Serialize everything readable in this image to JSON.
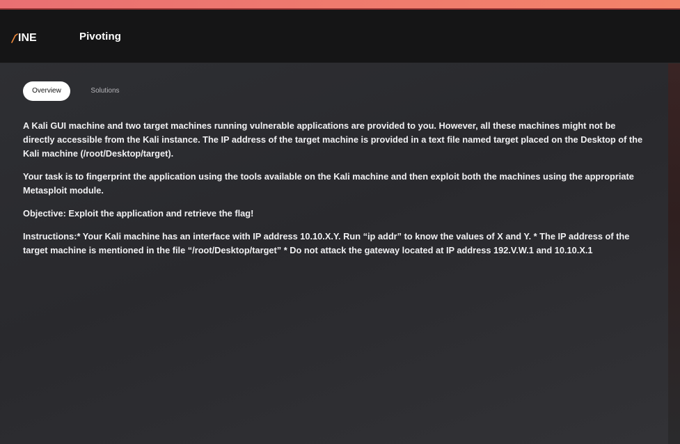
{
  "header": {
    "logo_text": "INE",
    "title": "Pivoting"
  },
  "tabs": [
    {
      "label": "Overview",
      "active": true
    },
    {
      "label": "Solutions",
      "active": false
    }
  ],
  "content": {
    "paragraphs": [
      "A Kali GUI machine and two target machines running vulnerable applications are provided to you. However, all these machines might not be directly accessible from the Kali instance. The IP address of the target machine is provided in a text file named target placed on the Desktop of the Kali machine (/root/Desktop/target).",
      "Your task is to fingerprint the application using the tools available on the Kali machine and then exploit both the machines using the appropriate Metasploit module.",
      "Objective: Exploit the application and retrieve the flag!",
      "Instructions:* Your Kali machine has an interface with IP address 10.10.X.Y. Run “ip addr” to know the values of X and Y. * The IP address of the target machine is mentioned in the file “/root/Desktop/target” * Do not attack the gateway located at IP address 192.V.W.1 and 10.10.X.1"
    ]
  },
  "colors": {
    "top_strip": "#ef7a6e",
    "header_bg": "#151516",
    "main_bg": "#2e2f33",
    "active_tab_bg": "#ffffff",
    "logo_accent": "#f08a3c"
  }
}
